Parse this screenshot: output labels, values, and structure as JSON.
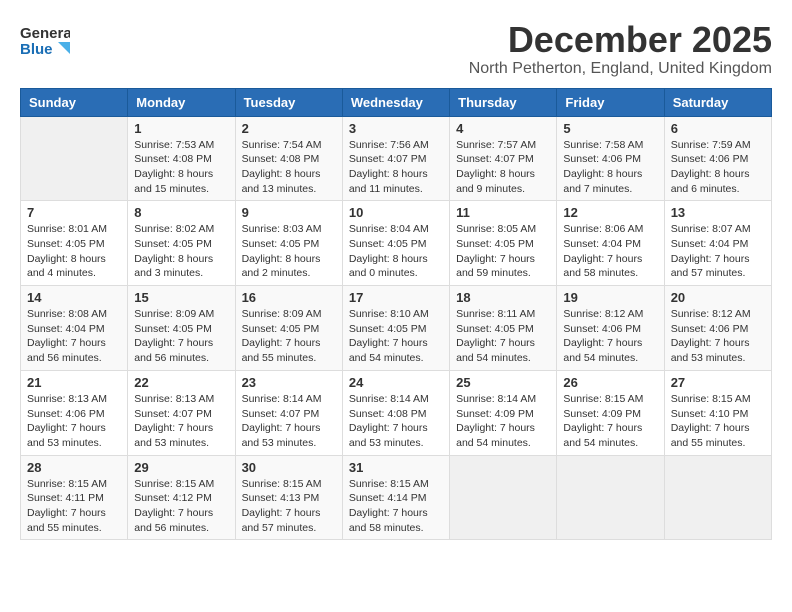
{
  "logo": {
    "line1": "General",
    "line2": "Blue"
  },
  "title": "December 2025",
  "subtitle": "North Petherton, England, United Kingdom",
  "days_of_week": [
    "Sunday",
    "Monday",
    "Tuesday",
    "Wednesday",
    "Thursday",
    "Friday",
    "Saturday"
  ],
  "weeks": [
    [
      {
        "day": "",
        "info": ""
      },
      {
        "day": "1",
        "info": "Sunrise: 7:53 AM\nSunset: 4:08 PM\nDaylight: 8 hours\nand 15 minutes."
      },
      {
        "day": "2",
        "info": "Sunrise: 7:54 AM\nSunset: 4:08 PM\nDaylight: 8 hours\nand 13 minutes."
      },
      {
        "day": "3",
        "info": "Sunrise: 7:56 AM\nSunset: 4:07 PM\nDaylight: 8 hours\nand 11 minutes."
      },
      {
        "day": "4",
        "info": "Sunrise: 7:57 AM\nSunset: 4:07 PM\nDaylight: 8 hours\nand 9 minutes."
      },
      {
        "day": "5",
        "info": "Sunrise: 7:58 AM\nSunset: 4:06 PM\nDaylight: 8 hours\nand 7 minutes."
      },
      {
        "day": "6",
        "info": "Sunrise: 7:59 AM\nSunset: 4:06 PM\nDaylight: 8 hours\nand 6 minutes."
      }
    ],
    [
      {
        "day": "7",
        "info": "Sunrise: 8:01 AM\nSunset: 4:05 PM\nDaylight: 8 hours\nand 4 minutes."
      },
      {
        "day": "8",
        "info": "Sunrise: 8:02 AM\nSunset: 4:05 PM\nDaylight: 8 hours\nand 3 minutes."
      },
      {
        "day": "9",
        "info": "Sunrise: 8:03 AM\nSunset: 4:05 PM\nDaylight: 8 hours\nand 2 minutes."
      },
      {
        "day": "10",
        "info": "Sunrise: 8:04 AM\nSunset: 4:05 PM\nDaylight: 8 hours\nand 0 minutes."
      },
      {
        "day": "11",
        "info": "Sunrise: 8:05 AM\nSunset: 4:05 PM\nDaylight: 7 hours\nand 59 minutes."
      },
      {
        "day": "12",
        "info": "Sunrise: 8:06 AM\nSunset: 4:04 PM\nDaylight: 7 hours\nand 58 minutes."
      },
      {
        "day": "13",
        "info": "Sunrise: 8:07 AM\nSunset: 4:04 PM\nDaylight: 7 hours\nand 57 minutes."
      }
    ],
    [
      {
        "day": "14",
        "info": "Sunrise: 8:08 AM\nSunset: 4:04 PM\nDaylight: 7 hours\nand 56 minutes."
      },
      {
        "day": "15",
        "info": "Sunrise: 8:09 AM\nSunset: 4:05 PM\nDaylight: 7 hours\nand 56 minutes."
      },
      {
        "day": "16",
        "info": "Sunrise: 8:09 AM\nSunset: 4:05 PM\nDaylight: 7 hours\nand 55 minutes."
      },
      {
        "day": "17",
        "info": "Sunrise: 8:10 AM\nSunset: 4:05 PM\nDaylight: 7 hours\nand 54 minutes."
      },
      {
        "day": "18",
        "info": "Sunrise: 8:11 AM\nSunset: 4:05 PM\nDaylight: 7 hours\nand 54 minutes."
      },
      {
        "day": "19",
        "info": "Sunrise: 8:12 AM\nSunset: 4:06 PM\nDaylight: 7 hours\nand 54 minutes."
      },
      {
        "day": "20",
        "info": "Sunrise: 8:12 AM\nSunset: 4:06 PM\nDaylight: 7 hours\nand 53 minutes."
      }
    ],
    [
      {
        "day": "21",
        "info": "Sunrise: 8:13 AM\nSunset: 4:06 PM\nDaylight: 7 hours\nand 53 minutes."
      },
      {
        "day": "22",
        "info": "Sunrise: 8:13 AM\nSunset: 4:07 PM\nDaylight: 7 hours\nand 53 minutes."
      },
      {
        "day": "23",
        "info": "Sunrise: 8:14 AM\nSunset: 4:07 PM\nDaylight: 7 hours\nand 53 minutes."
      },
      {
        "day": "24",
        "info": "Sunrise: 8:14 AM\nSunset: 4:08 PM\nDaylight: 7 hours\nand 53 minutes."
      },
      {
        "day": "25",
        "info": "Sunrise: 8:14 AM\nSunset: 4:09 PM\nDaylight: 7 hours\nand 54 minutes."
      },
      {
        "day": "26",
        "info": "Sunrise: 8:15 AM\nSunset: 4:09 PM\nDaylight: 7 hours\nand 54 minutes."
      },
      {
        "day": "27",
        "info": "Sunrise: 8:15 AM\nSunset: 4:10 PM\nDaylight: 7 hours\nand 55 minutes."
      }
    ],
    [
      {
        "day": "28",
        "info": "Sunrise: 8:15 AM\nSunset: 4:11 PM\nDaylight: 7 hours\nand 55 minutes."
      },
      {
        "day": "29",
        "info": "Sunrise: 8:15 AM\nSunset: 4:12 PM\nDaylight: 7 hours\nand 56 minutes."
      },
      {
        "day": "30",
        "info": "Sunrise: 8:15 AM\nSunset: 4:13 PM\nDaylight: 7 hours\nand 57 minutes."
      },
      {
        "day": "31",
        "info": "Sunrise: 8:15 AM\nSunset: 4:14 PM\nDaylight: 7 hours\nand 58 minutes."
      },
      {
        "day": "",
        "info": ""
      },
      {
        "day": "",
        "info": ""
      },
      {
        "day": "",
        "info": ""
      }
    ]
  ]
}
